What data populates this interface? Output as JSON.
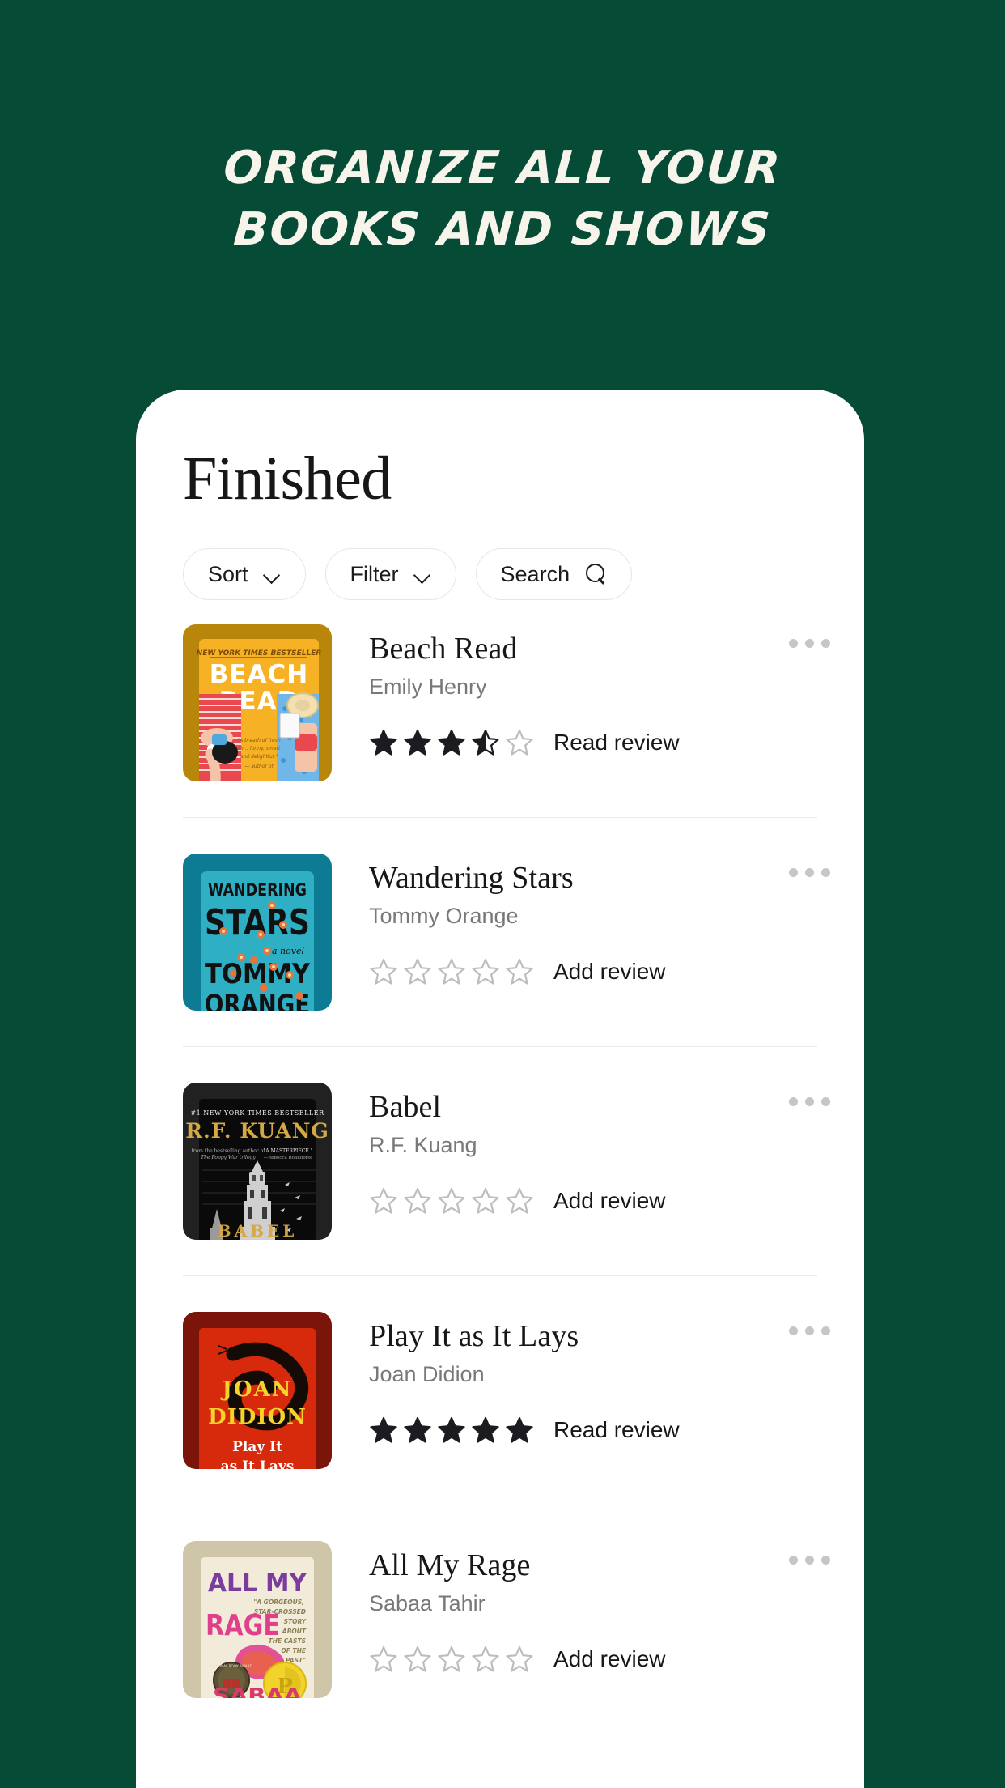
{
  "hero": {
    "line1": "Organize All Your",
    "line2": "Books and Shows"
  },
  "theme": {
    "background": "#064B35",
    "card_background": "#FFFFFF",
    "title_color": "#17171A",
    "author_color": "#787878",
    "star_filled": "#1B1B20",
    "star_empty": "#BDBDBD"
  },
  "card": {
    "title": "Finished",
    "controls": [
      {
        "label": "Sort",
        "icon": "chevron-down-icon"
      },
      {
        "label": "Filter",
        "icon": "chevron-down-icon"
      },
      {
        "label": "Search",
        "icon": "search-icon"
      }
    ],
    "overflow_icon": "more-options-icon",
    "books": [
      {
        "title": "Beach Read",
        "author": "Emily Henry",
        "rating": 3.5,
        "review_label": "Read review",
        "cover": {
          "name": "beach-read-cover",
          "background": "#B8860B",
          "inner": "#F6B224",
          "accent": "#E8484E",
          "accent2": "#6FB7E8"
        }
      },
      {
        "title": "Wandering Stars",
        "author": "Tommy Orange",
        "rating": 0,
        "review_label": "Add review",
        "cover": {
          "name": "wandering-stars-cover",
          "background": "#0E7B94",
          "inner": "#2FAFC4",
          "accent": "#111111",
          "accent2": "#E8743B"
        }
      },
      {
        "title": "Babel",
        "author": "R.F. Kuang",
        "rating": 0,
        "review_label": "Add review",
        "cover": {
          "name": "babel-cover",
          "background": "#212121",
          "inner": "#0A0A0A",
          "accent": "#D4A843",
          "accent2": "#8E8E8E"
        }
      },
      {
        "title": "Play It as It Lays",
        "author": "Joan Didion",
        "rating": 5,
        "review_label": "Read review",
        "cover": {
          "name": "play-it-as-it-lays-cover",
          "background": "#7C1509",
          "inner": "#D7290C",
          "accent": "#F6D32B",
          "accent2": "#140B07"
        }
      },
      {
        "title": "All My Rage",
        "author": "Sabaa Tahir",
        "rating": 0,
        "review_label": "Add review",
        "cover": {
          "name": "all-my-rage-cover",
          "background": "#CFC5A9",
          "inner": "#F3EBDA",
          "accent": "#7B3C9E",
          "accent2": "#E0408B"
        }
      }
    ]
  }
}
